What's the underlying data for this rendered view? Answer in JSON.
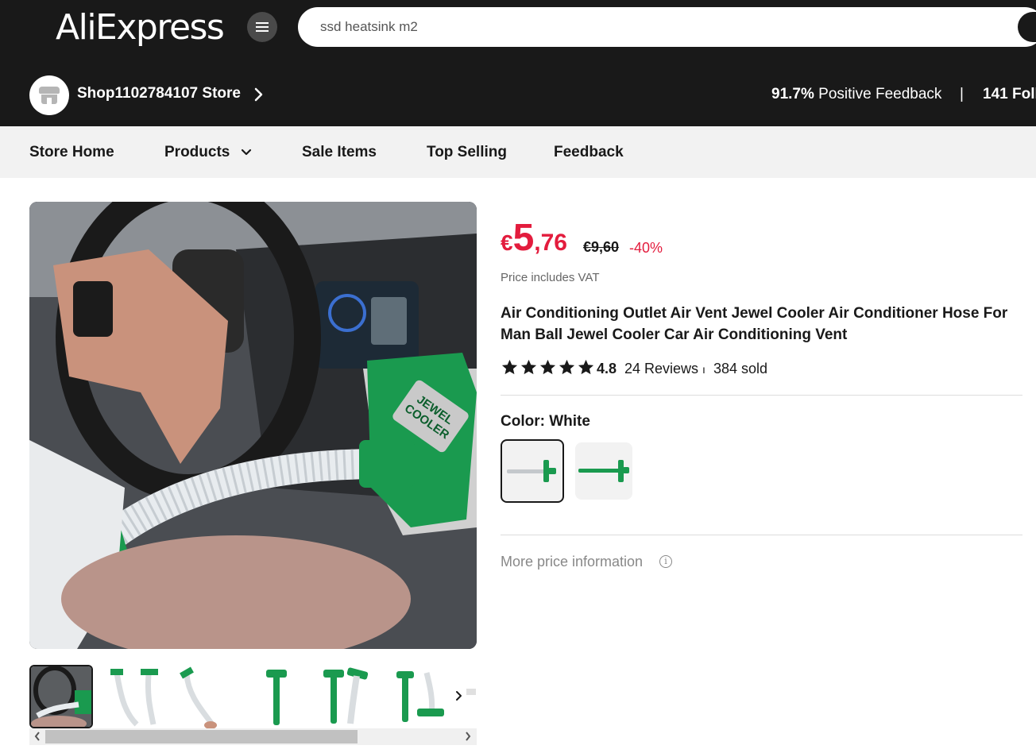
{
  "header": {
    "logo_text": "AliExpress",
    "search": {
      "value": "ssd heatsink m2",
      "placeholder": ""
    }
  },
  "store": {
    "name": "Shop1102784107 Store",
    "feedback_percent": "91.7%",
    "feedback_label": "Positive Feedback",
    "separator": "|",
    "followers": "141 Foll"
  },
  "nav": {
    "items": [
      {
        "label": "Store Home"
      },
      {
        "label": "Products"
      },
      {
        "label": "Sale Items"
      },
      {
        "label": "Top Selling"
      },
      {
        "label": "Feedback"
      }
    ]
  },
  "product": {
    "price": {
      "currency": "€",
      "integer": "5",
      "decimal": ",76"
    },
    "old_price": "€9,60",
    "discount": "-40%",
    "vat_note": "Price includes VAT",
    "title": "Air Conditioning Outlet Air Vent Jewel Cooler Air Conditioner Hose For Man Ball Jewel Cooler Car Air Conditioning Vent",
    "rating": "4.8",
    "stars": 5,
    "reviews": "24 Reviews",
    "rating_separator": "ı",
    "sold": "384 sold",
    "color_label": "Color: White",
    "more_price_info": "More price information",
    "info_glyph": "i"
  },
  "colors": {
    "accent_red": "#e31c3d",
    "header_bg": "#191919",
    "product_green": "#1a9a4f"
  },
  "icons": {
    "menu": "hamburger-icon",
    "store": "shop-icon",
    "chevron": "chevron-right-icon",
    "dropdown": "chevron-down-icon",
    "info": "info-icon",
    "star": "star-icon"
  }
}
